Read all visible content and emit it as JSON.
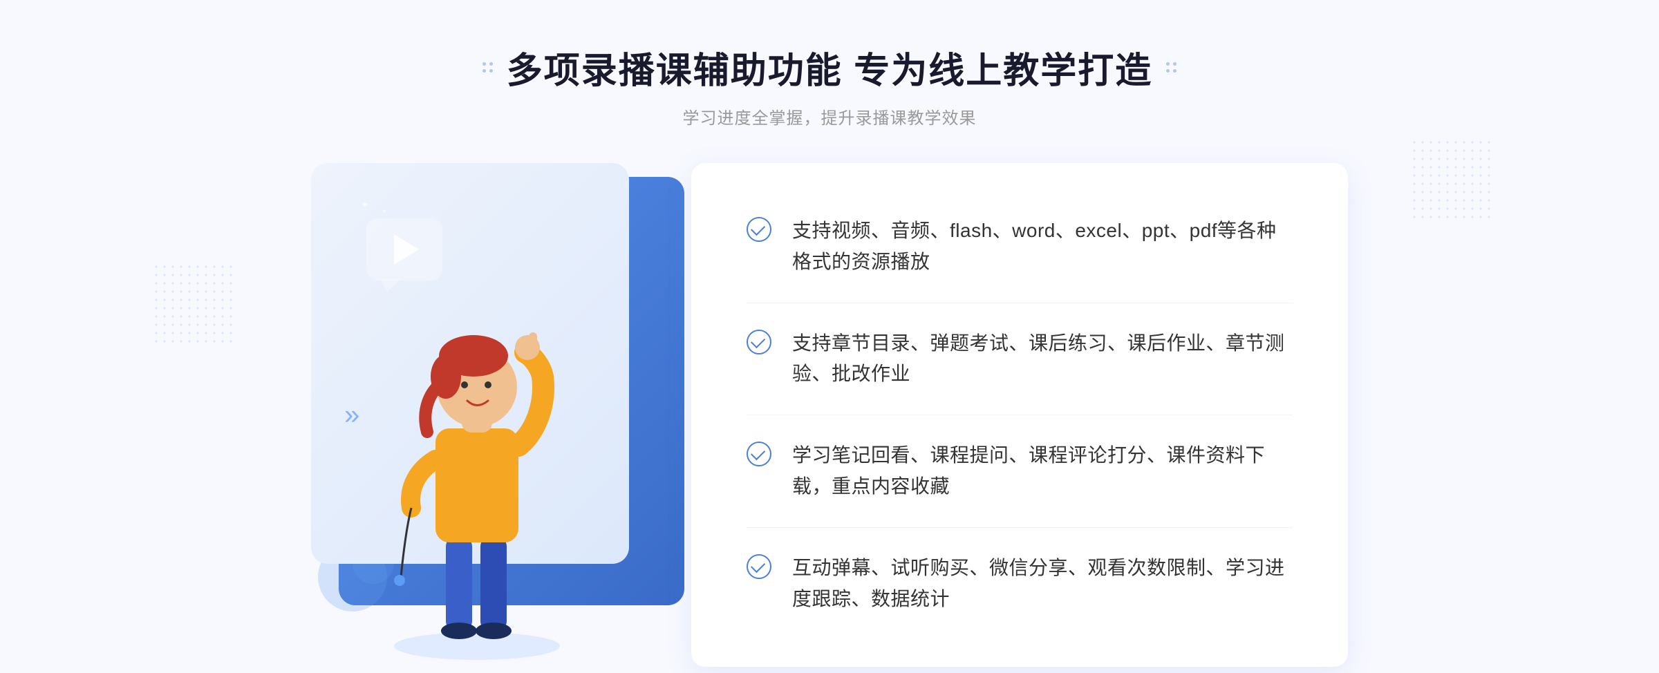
{
  "page": {
    "background_color": "#f8f9ff"
  },
  "header": {
    "main_title": "多项录播课辅助功能 专为线上教学打造",
    "sub_title": "学习进度全掌握，提升录播课教学效果"
  },
  "features": [
    {
      "id": 1,
      "text": "支持视频、音频、flash、word、excel、ppt、pdf等各种格式的资源播放"
    },
    {
      "id": 2,
      "text": "支持章节目录、弹题考试、课后练习、课后作业、章节测验、批改作业"
    },
    {
      "id": 3,
      "text": "学习笔记回看、课程提问、课程评论打分、课件资料下载，重点内容收藏"
    },
    {
      "id": 4,
      "text": "互动弹幕、试听购买、微信分享、观看次数限制、学习进度跟踪、数据统计"
    }
  ],
  "decorations": {
    "left_arrow": "»",
    "play_label": "play"
  }
}
